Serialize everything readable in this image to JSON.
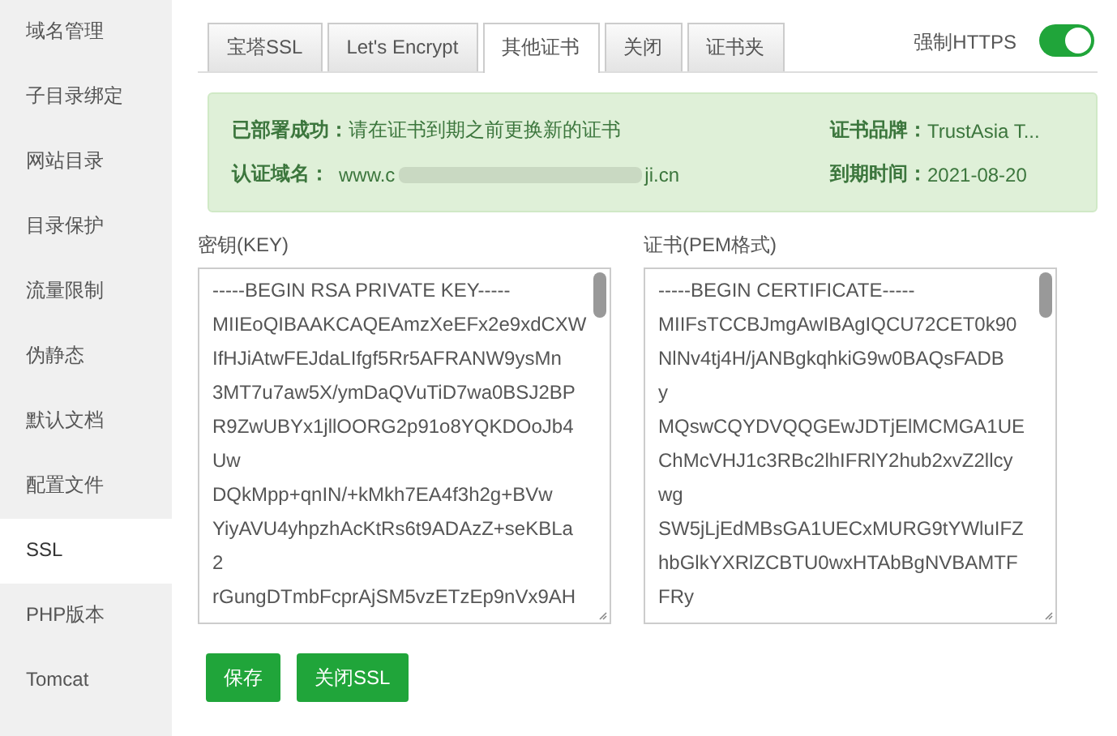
{
  "sidebar": {
    "items": [
      {
        "label": "域名管理",
        "selected": false
      },
      {
        "label": "子目录绑定",
        "selected": false
      },
      {
        "label": "网站目录",
        "selected": false
      },
      {
        "label": "目录保护",
        "selected": false
      },
      {
        "label": "流量限制",
        "selected": false
      },
      {
        "label": "伪静态",
        "selected": false
      },
      {
        "label": "默认文档",
        "selected": false
      },
      {
        "label": "配置文件",
        "selected": false
      },
      {
        "label": "SSL",
        "selected": true
      },
      {
        "label": "PHP版本",
        "selected": false
      },
      {
        "label": "Tomcat",
        "selected": false
      }
    ]
  },
  "tabs": [
    {
      "label": "宝塔SSL",
      "selected": false
    },
    {
      "label": "Let's Encrypt",
      "selected": false
    },
    {
      "label": "其他证书",
      "selected": true
    },
    {
      "label": "关闭",
      "selected": false
    },
    {
      "label": "证书夹",
      "selected": false
    }
  ],
  "force_https": {
    "label": "强制HTTPS",
    "on": true
  },
  "status": {
    "title": "已部署成功：",
    "message": "请在证书到期之前更换新的证书",
    "domain_label": "认证域名：",
    "domain_start": "www.c",
    "domain_end": "ji.cn",
    "brand_label": "证书品牌：",
    "brand": "TrustAsia T...",
    "expiry_label": "到期时间：",
    "expiry": "2021-08-20"
  },
  "key_field": {
    "label": "密钥(KEY)",
    "lines": [
      "-----BEGIN RSA PRIVATE KEY-----",
      "MIIEoQIBAAKCAQEAmzXeEFx2e9xdCXW",
      "IfHJiAtwFEJdaLIfgf5Rr5AFRANW9ysMn",
      "3MT7u7aw5X/ymDaQVuTiD7wa0BSJ2BP",
      "R9ZwUBYx1jllOORG2p91o8YQKDOoJb4",
      "Uw",
      "DQkMpp+qnIN/+kMkh7EA4f3h2g+BVw",
      "YiyAVU4yhpzhAcKtRs6t9ADAzZ+seKBLa",
      "2",
      "rGungDTmbFcprAjSM5vzETzEp9nVx9AH"
    ]
  },
  "cert_field": {
    "label": "证书(PEM格式)",
    "lines": [
      "-----BEGIN CERTIFICATE-----",
      "MIIFsTCCBJmgAwIBAgIQCU72CET0k90",
      "NlNv4tj4H/jANBgkqhkiG9w0BAQsFADB",
      "y",
      "MQswCQYDVQQGEwJDTjElMCMGA1UE",
      "ChMcVHJ1c3RBc2lhIFRlY2hub2xvZ2llcy",
      "wg",
      "SW5jLjEdMBsGA1UECxMURG9tYWluIFZ",
      "hbGlkYXRlZCBTU0wxHTAbBgNVBAMTF",
      "FRy"
    ]
  },
  "buttons": [
    "保存",
    "关闭SSL"
  ]
}
